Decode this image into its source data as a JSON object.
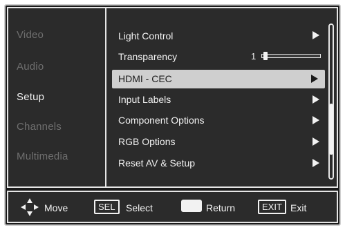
{
  "sidebar": {
    "items": [
      {
        "label": "Video"
      },
      {
        "label": "Audio"
      },
      {
        "label": "Setup"
      },
      {
        "label": "Channels"
      },
      {
        "label": "Multimedia"
      }
    ],
    "active": "Setup"
  },
  "menu": {
    "items": [
      {
        "label": "Light Control"
      },
      {
        "label": "Transparency"
      },
      {
        "label": "HDMI - CEC"
      },
      {
        "label": "Input Labels"
      },
      {
        "label": "Component Options"
      },
      {
        "label": "RGB Options"
      },
      {
        "label": "Reset AV & Setup"
      }
    ],
    "transparency_value": "1",
    "highlighted": "HDMI - CEC"
  },
  "footer": {
    "move_label": "Move",
    "sel_key": "SEL",
    "select_label": "Select",
    "return_label": "Return",
    "exit_key": "EXIT",
    "exit_label": "Exit"
  },
  "colors": {
    "background": "#2b2b2b",
    "highlight": "#cfcfcf",
    "text": "#f2f2f2",
    "dim_text": "#6f6f6f"
  }
}
